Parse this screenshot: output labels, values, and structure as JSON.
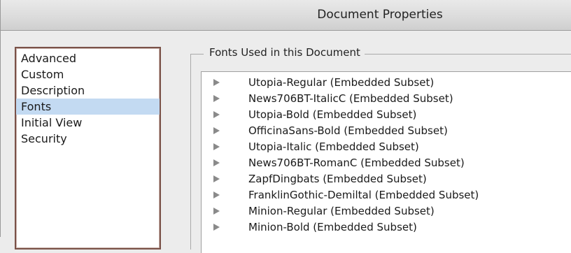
{
  "window": {
    "title": "Document Properties"
  },
  "sidebar": {
    "items": [
      {
        "label": "Advanced"
      },
      {
        "label": "Custom"
      },
      {
        "label": "Description"
      },
      {
        "label": "Fonts",
        "selected": true
      },
      {
        "label": "Initial View"
      },
      {
        "label": "Security"
      }
    ]
  },
  "fonts_panel": {
    "group_title": "Fonts Used in this Document",
    "fonts": [
      {
        "name": "Utopia-Regular (Embedded Subset)"
      },
      {
        "name": "News706BT-ItalicC (Embedded Subset)"
      },
      {
        "name": "Utopia-Bold (Embedded Subset)"
      },
      {
        "name": "OfficinaSans-Bold (Embedded Subset)"
      },
      {
        "name": "Utopia-Italic (Embedded Subset)"
      },
      {
        "name": "News706BT-RomanC (Embedded Subset)"
      },
      {
        "name": "ZapfDingbats (Embedded Subset)"
      },
      {
        "name": "FranklinGothic-Demiltal (Embedded Subset)"
      },
      {
        "name": "Minion-Regular (Embedded Subset)"
      },
      {
        "name": "Minion-Bold (Embedded Subset)"
      }
    ]
  },
  "colors": {
    "selection": "#c3daf2",
    "expander": "#8a8a8a"
  },
  "icons": {
    "expander": "disclosure-triangle-right-icon"
  }
}
